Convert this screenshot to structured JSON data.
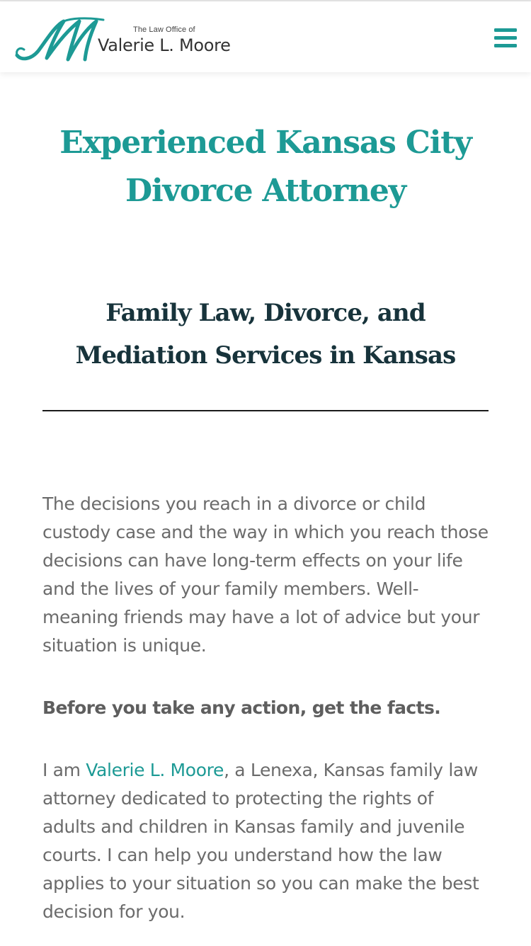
{
  "brand": {
    "small_text": "The Law Office of",
    "name": "Valerie L. Moore",
    "accent_color": "#1d9a95",
    "logo_letter_icon": "script-m-monogram"
  },
  "header": {
    "menu_icon": "hamburger-menu-icon"
  },
  "hero": {
    "title": "Experienced Kansas City Divorce Attorney"
  },
  "section": {
    "heading": "Family Law, Divorce, and Mediation Services in Kansas"
  },
  "content": {
    "paragraph1": "The decisions you reach in a divorce or child custody case and the way in which you reach those decisions can have long-term effects on your life and the lives of your family members. Well-meaning friends may have a lot of advice but your situation is unique.",
    "emphasis": "Before you take any action, get the facts.",
    "paragraph3_prefix": "I am ",
    "paragraph3_link": "Valerie L. Moore",
    "paragraph3_suffix": ", a Lenexa, Kansas family law attorney dedicated to protecting the rights of adults and children in Kansas family and juvenile courts. I can help you understand how the law applies to your situation so you can make the best decision for you."
  }
}
